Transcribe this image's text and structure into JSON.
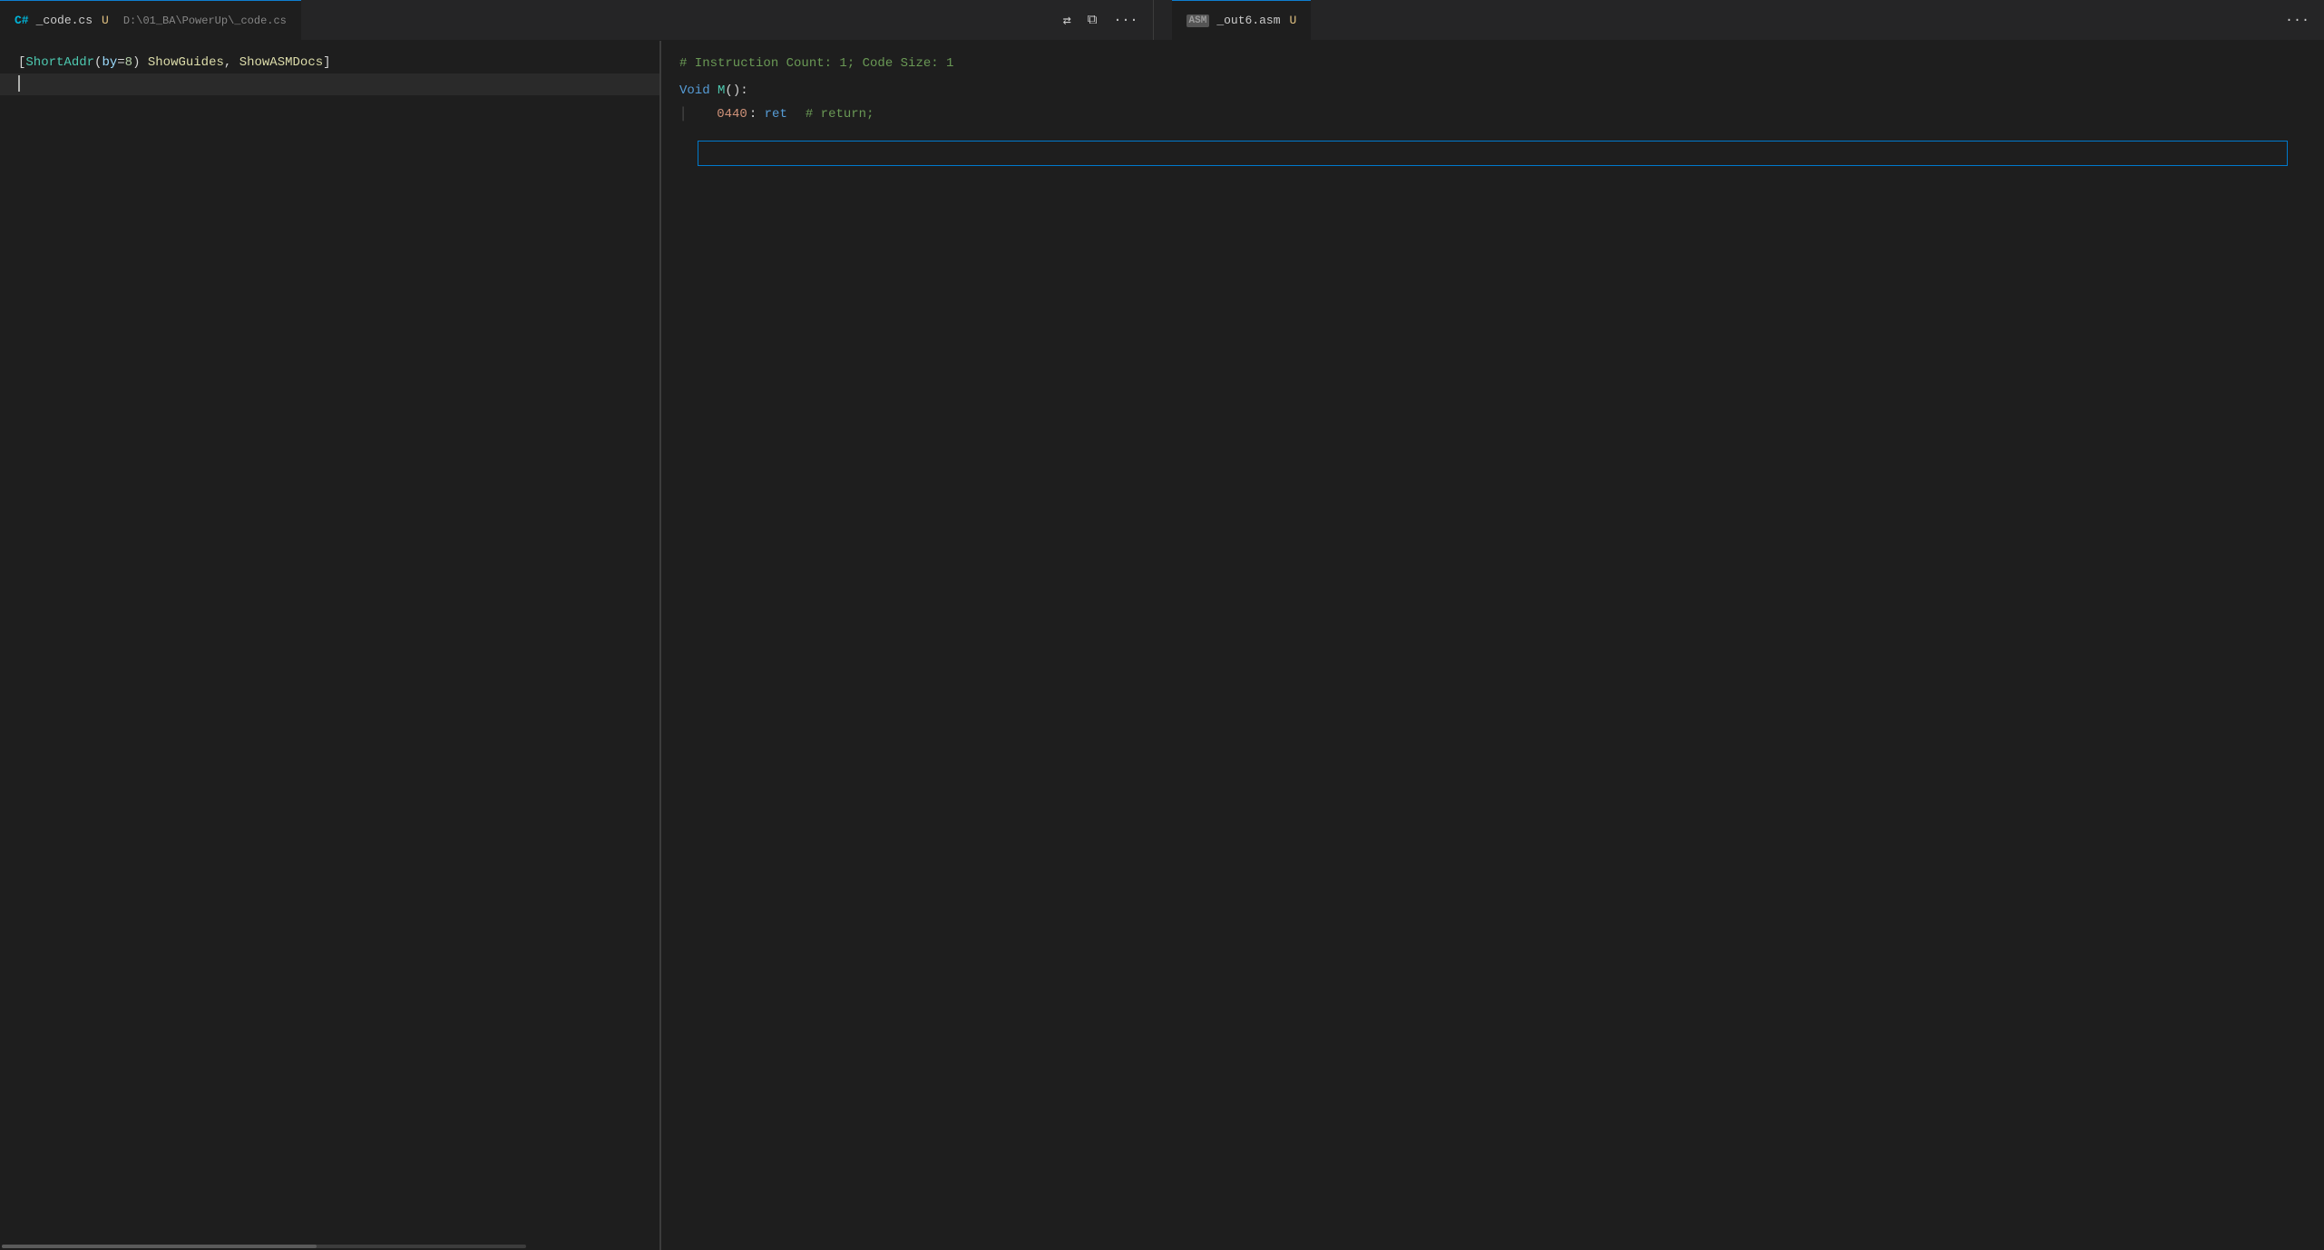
{
  "tabs": {
    "left": {
      "icon": "C#",
      "filename": "_code.cs",
      "modified_indicator": "U",
      "path": "D:\\01_BA\\PowerUp\\_code.cs"
    },
    "right": {
      "icon": "ASM",
      "filename": "_out6.asm",
      "modified_indicator": "U"
    }
  },
  "toolbar": {
    "sync_icon": "⇄",
    "split_icon": "⧉",
    "more_icon": "···"
  },
  "left_editor": {
    "line1": {
      "bracket_open": "[",
      "attribute_name": "ShortAddr",
      "paren_open": "(",
      "param": "by",
      "equals": "=",
      "number": "8",
      "paren_close": ")",
      "space": " ",
      "keyword1": "ShowGuides",
      "comma": ",",
      "space2": " ",
      "keyword2": "ShowASMDocs",
      "bracket_close": "]"
    },
    "line2": {
      "empty": ""
    }
  },
  "right_editor": {
    "comment_line": "# Instruction Count: 1; Code Size: 1",
    "void_keyword": "Void",
    "method_name": "M",
    "paren": "()",
    "colon": ":",
    "addr": "0440",
    "colon2": ":",
    "instr": "ret",
    "instr_comment": "# return;"
  },
  "colors": {
    "background": "#1e1e1e",
    "tab_active_bg": "#1e1e1e",
    "tab_inactive_bg": "#2d2d2d",
    "accent": "#0e7dcf",
    "text_primary": "#d4d4d4",
    "comment": "#6a9955",
    "keyword_blue": "#569cd6",
    "teal": "#4ec9b0",
    "yellow": "#dcdcaa",
    "orange": "#ce9178",
    "addr_color": "#ce9178"
  }
}
